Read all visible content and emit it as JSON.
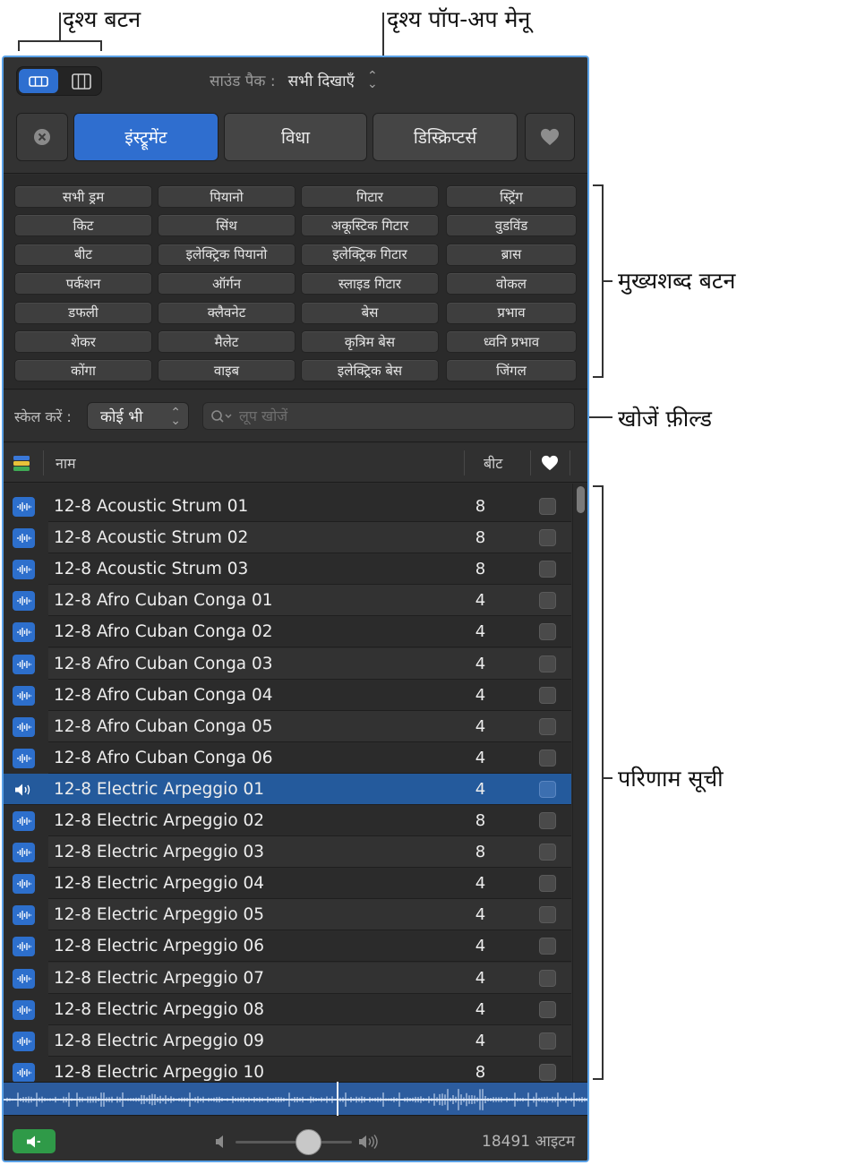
{
  "callouts": {
    "view_buttons": "दृश्य बटन",
    "view_popup": "दृश्य पॉप-अप मेनू",
    "keyword_buttons": "मुख्यशब्द बटन",
    "search_field": "खोजें फ़ील्ड",
    "results_list": "परिणाम सूची"
  },
  "header": {
    "soundpack_label": "साउंड पैक :",
    "soundpack_value": "सभी दिखाएँ"
  },
  "tabs": {
    "instrument": "इंस्ट्रूमेंट",
    "genre": "विधा",
    "descriptors": "डिस्क्रिप्टर्स"
  },
  "keywords": [
    [
      "सभी ड्रम",
      "पियानो",
      "गिटार",
      "स्ट्रिंग"
    ],
    [
      "किट",
      "सिंथ",
      "अकूस्टिक गिटार",
      "वुडविंड"
    ],
    [
      "बीट",
      "इलेक्ट्रिक पियानो",
      "इलेक्ट्रिक गिटार",
      "ब्रास"
    ],
    [
      "पर्कशन",
      "ऑर्गन",
      "स्लाइड गिटार",
      "वोकल"
    ],
    [
      "डफली",
      "क्लैवनेट",
      "बेस",
      "प्रभाव"
    ],
    [
      "शेकर",
      "मैलेट",
      "कृत्रिम बेस",
      "ध्वनि प्रभाव"
    ],
    [
      "कोंगा",
      "वाइब",
      "इलेक्ट्रिक बेस",
      "जिंगल"
    ]
  ],
  "search": {
    "scale_label": "स्केल करें :",
    "scale_value": "कोई भी",
    "placeholder": "लूप खोजें"
  },
  "list_header": {
    "name": "नाम",
    "beats": "बीट"
  },
  "rows": [
    {
      "name": "12-8 Acoustic Strum 01",
      "beats": "8"
    },
    {
      "name": "12-8 Acoustic Strum 02",
      "beats": "8"
    },
    {
      "name": "12-8 Acoustic Strum 03",
      "beats": "8"
    },
    {
      "name": "12-8 Afro Cuban Conga 01",
      "beats": "4"
    },
    {
      "name": "12-8 Afro Cuban Conga 02",
      "beats": "4"
    },
    {
      "name": "12-8 Afro Cuban Conga 03",
      "beats": "4"
    },
    {
      "name": "12-8 Afro Cuban Conga 04",
      "beats": "4"
    },
    {
      "name": "12-8 Afro Cuban Conga 05",
      "beats": "4"
    },
    {
      "name": "12-8 Afro Cuban Conga 06",
      "beats": "4"
    },
    {
      "name": "12-8 Electric Arpeggio 01",
      "beats": "4",
      "selected": true
    },
    {
      "name": "12-8 Electric Arpeggio 02",
      "beats": "8"
    },
    {
      "name": "12-8 Electric Arpeggio 03",
      "beats": "8"
    },
    {
      "name": "12-8 Electric Arpeggio 04",
      "beats": "4"
    },
    {
      "name": "12-8 Electric Arpeggio 05",
      "beats": "4"
    },
    {
      "name": "12-8 Electric Arpeggio 06",
      "beats": "4"
    },
    {
      "name": "12-8 Electric Arpeggio 07",
      "beats": "4"
    },
    {
      "name": "12-8 Electric Arpeggio 08",
      "beats": "4"
    },
    {
      "name": "12-8 Electric Arpeggio 09",
      "beats": "4"
    },
    {
      "name": "12-8 Electric Arpeggio 10",
      "beats": "8"
    }
  ],
  "footer": {
    "item_count": "18491 आइटम"
  },
  "colors": {
    "accent": "#2f6ecf",
    "selection": "#245a9c",
    "preview_green": "#2f9a48",
    "panel_border": "#5aa1e6"
  },
  "icons": {
    "row_icon": "audio-loop-waveform-icon",
    "selected_row_icon": "speaker-playing-icon",
    "favorites": "heart-icon",
    "clear": "clear-circle-icon"
  }
}
